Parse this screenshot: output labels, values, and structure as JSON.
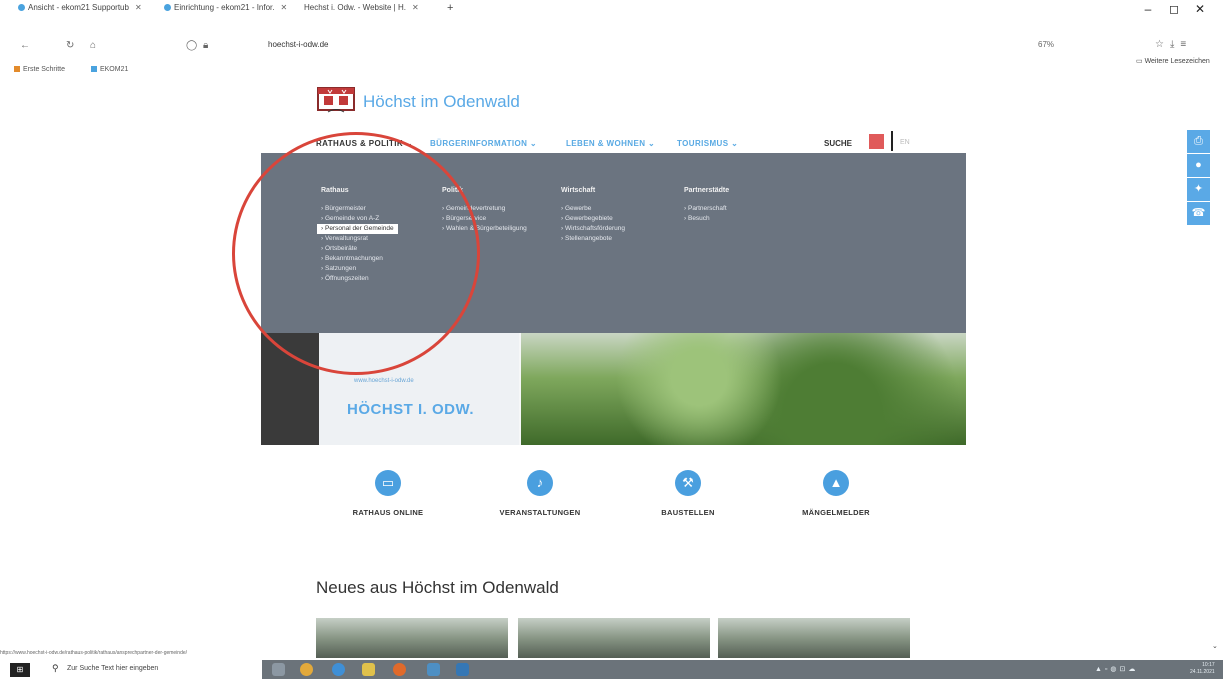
{
  "browser": {
    "tabs": [
      {
        "label": "Ansicht - ekom21 Supportub"
      },
      {
        "label": "Einrichtung - ekom21 - Infor."
      },
      {
        "label": "Hechst i. Odw. - Website | H."
      }
    ],
    "new_tab": "+",
    "window_controls": [
      "–",
      "◻",
      "✕"
    ],
    "url": "hoechst-i-odw.de",
    "zoom": "67%",
    "bookmarks": [
      "Erste Schritte",
      "EKOM21"
    ],
    "other_bookmarks": "Weitere Lesezeichen",
    "status_url": "https://www.hoechst-i-odw.de/rathaus-politik/rathaus/ansprechpartner-der-gemeinde/"
  },
  "site": {
    "title": "Höchst im Odenwald",
    "nav": [
      {
        "label": "RATHAUS & POLITIK ⌄"
      },
      {
        "label": "BÜRGERINFORMATION ⌄"
      },
      {
        "label": "LEBEN & WOHNEN ⌄"
      },
      {
        "label": "TOURISMUS ⌄"
      }
    ],
    "search_label": "SUCHE",
    "lang": "EN",
    "megamenu": {
      "columns": [
        {
          "heading": "Rathaus",
          "items": [
            "Bürgermeister",
            "Gemeinde von A-Z",
            "Personal der Gemeinde",
            "Verwaltungsrat",
            "Ortsbeiräte",
            "Bekanntmachungen",
            "Satzungen",
            "Öffnungszeiten"
          ]
        },
        {
          "heading": "Politik",
          "items": [
            "Gemeindevertretung",
            "Bürgerservice",
            "Wahlen & Bürgerbeteiligung"
          ]
        },
        {
          "heading": "Wirtschaft",
          "items": [
            "Gewerbe",
            "Gewerbegebiete",
            "Wirtschaftsförderung",
            "Stellenangebote"
          ]
        },
        {
          "heading": "Partnerstädte",
          "items": [
            "Partnerschaft",
            "Besuch"
          ]
        }
      ]
    },
    "hero": {
      "subtitle": "www.hoechst-i-odw.de",
      "brand": "HÖCHST I. ODW."
    },
    "quick_links": [
      {
        "label": "RATHAUS ONLINE",
        "icon": "monitor-icon"
      },
      {
        "label": "VERANSTALTUNGEN",
        "icon": "guitar-icon"
      },
      {
        "label": "BAUSTELLEN",
        "icon": "construction-icon"
      },
      {
        "label": "MÄNGELMELDER",
        "icon": "alert-icon"
      }
    ],
    "news_heading": "Neues aus Höchst im Odenwald"
  },
  "taskbar": {
    "search_placeholder": "Zur Suche Text hier eingeben",
    "time": "10:17",
    "date": "24.11.2021"
  },
  "colors": {
    "accent": "#5aa9e6",
    "menu_bg": "#6b7480",
    "highlight": "#d9453a",
    "search_btn": "#e05a5a"
  }
}
